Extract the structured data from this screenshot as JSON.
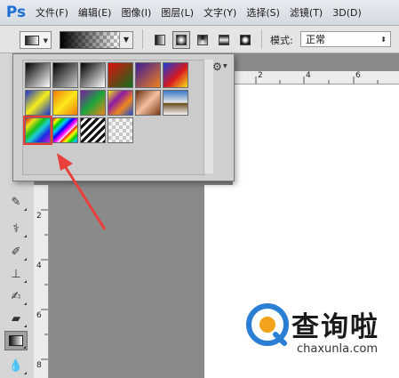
{
  "menubar": {
    "logo": "Ps",
    "items": [
      "文件(F)",
      "编辑(E)",
      "图像(I)",
      "图层(L)",
      "文字(Y)",
      "选择(S)",
      "滤镜(T)",
      "3D(D)"
    ]
  },
  "options": {
    "mode_label": "模式:",
    "mode_value": "正常"
  },
  "rulers": {
    "top_numbers": [
      "2",
      "4",
      "6"
    ],
    "left_numbers": [
      "2",
      "4",
      "6",
      "8"
    ]
  },
  "gradient_picker": {
    "swatches": [
      {
        "name": "foreground-to-background",
        "css": "linear-gradient(135deg,#000 0%,#fff 100%)"
      },
      {
        "name": "foreground-to-transparent",
        "css": "linear-gradient(135deg,#000 0%,rgba(0,0,0,0) 100%)"
      },
      {
        "name": "black-white",
        "css": "linear-gradient(135deg,#000 0%,#fff 100%)"
      },
      {
        "name": "red-green",
        "css": "linear-gradient(135deg,#d11 0%,#116e1a 100%)"
      },
      {
        "name": "violet-orange",
        "css": "linear-gradient(135deg,#3a1a9a 0%,#f2801a 100%)"
      },
      {
        "name": "blue-red-yellow",
        "css": "linear-gradient(135deg,#1a3dd8 0%,#d8181e 55%,#f3e21a 100%)"
      },
      {
        "name": "blue-yellow-blue",
        "css": "linear-gradient(135deg,#1a2fd2 0%,#f2ee1a 50%,#1a2fd2 100%)"
      },
      {
        "name": "orange-yellow-orange",
        "css": "linear-gradient(135deg,#f07a0d 0%,#fbe91a 50%,#f07a0d 100%)"
      },
      {
        "name": "violet-green-orange",
        "css": "linear-gradient(135deg,#7a1aa6 0%,#1aa63a 50%,#f0861a 100%)"
      },
      {
        "name": "yellow-violet-orange-blue",
        "css": "linear-gradient(135deg,#f3e21a 0%,#8a1aa6 35%,#f0861a 65%,#1a4bd8 100%)"
      },
      {
        "name": "copper",
        "css": "linear-gradient(135deg,#6a2e10 0%,#f2c0a0 50%,#7a3814 100%)"
      },
      {
        "name": "chrome",
        "css": "linear-gradient(180deg,#3a78c8 0%,#e8e8e8 50%,#6a4a1a 52%,#f4f4f4 100%)"
      },
      {
        "name": "spectrum",
        "css": "linear-gradient(135deg,#d01818 0%,#f0e01a 20%,#18c018 40%,#18d0d0 55%,#1a2ae0 75%,#d018d0 100%)"
      },
      {
        "name": "transparent-rainbow",
        "css": "repeating-linear-gradient(135deg,#f11 0px,#ff0 4px,#0c0 8px,#0cf 12px,#00f 16px,#f0f 20px,#fff 24px)"
      },
      {
        "name": "transparent-stripes",
        "css": "repeating-linear-gradient(135deg,#111 0px,#111 3px,#fff 3px,#fff 6px)"
      },
      {
        "name": "transparent-checker",
        "css": "repeating-conic-gradient(#c8c8c8 0% 25%, #f4f4f4 0% 50%) 0 0/8px 8px"
      }
    ],
    "selected_index": 12
  },
  "watermark": {
    "brand": "查询啦",
    "url": "chaxunla.com"
  },
  "colors": {
    "accent": "#e8413b",
    "brand_blue": "#2a7fd4",
    "brand_orange": "#f3a21b"
  }
}
